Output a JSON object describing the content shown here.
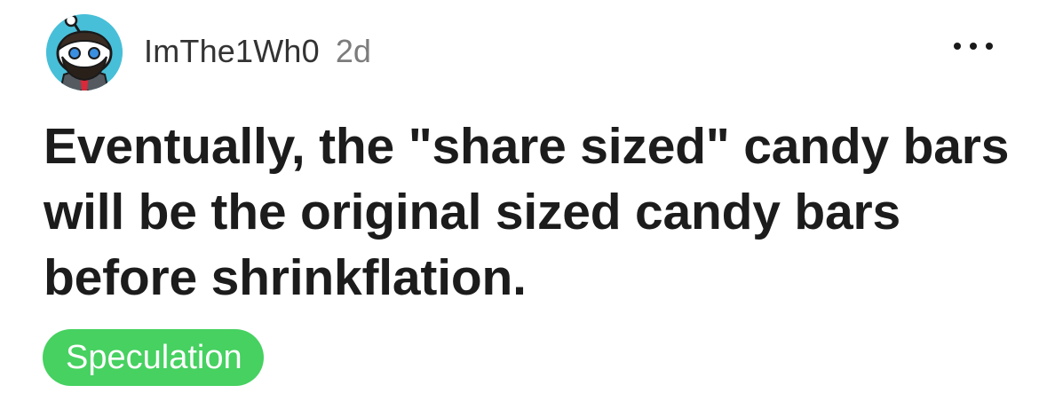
{
  "post": {
    "author": {
      "username": "ImThe1Wh0",
      "avatar_icon": "snoo-avatar-icon"
    },
    "age": "2d",
    "more_icon": "more-options-icon",
    "title": "Eventually, the \"share sized\" candy bars will be the original sized candy bars before shrinkflation.",
    "flair": {
      "label": "Speculation",
      "color": "#46d160"
    }
  },
  "colors": {
    "avatar_background": "#48bfd8",
    "text": "#1c1c1c",
    "muted_text": "#7c7c7c"
  }
}
